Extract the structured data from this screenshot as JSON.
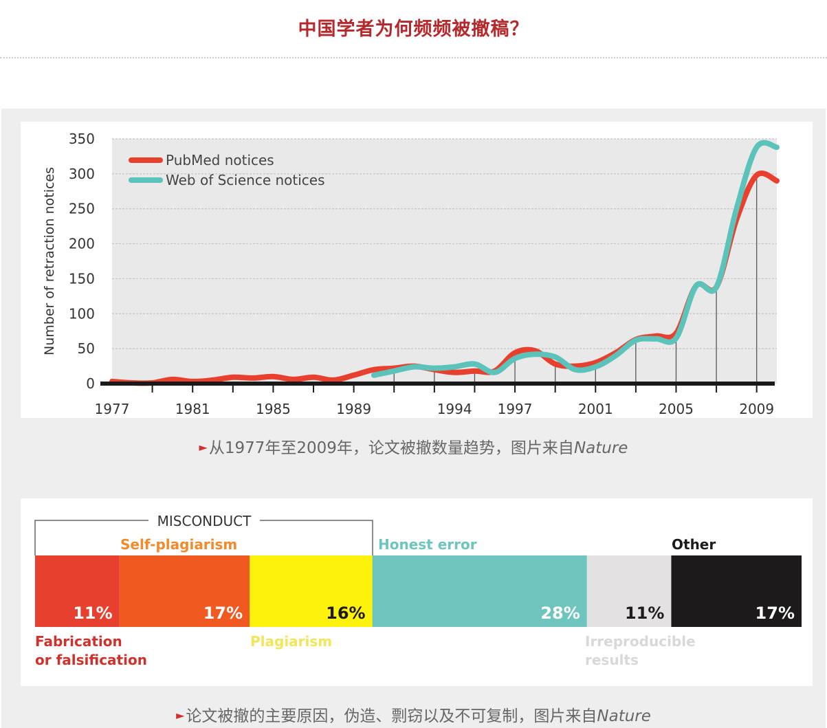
{
  "header": {
    "title": "中国学者为何频频被撤稿？"
  },
  "captions": {
    "first": {
      "prefix": "从1977年至2009年，论文被撤数量趋势，图片来自",
      "source": "Nature"
    },
    "second": {
      "prefix": "论文被撤的主要原因，伪造、剽窃以及不可复制，图片来自",
      "source": "Nature"
    }
  },
  "colors": {
    "pubmed": "#e8402f",
    "wos": "#5cc3bb",
    "fabrication": "#e8402f",
    "self_plagiarism": "#f05a20",
    "plagiarism": "#fdf20b",
    "honest_error": "#6dc5bd",
    "irreproducible": "#e3e1e2",
    "other": "#1d1a1b"
  },
  "chart_data": [
    {
      "type": "line",
      "title": "",
      "xlabel": "",
      "ylabel": "Number of retraction notices",
      "ylim": [
        0,
        350
      ],
      "xlim": [
        1977,
        2010
      ],
      "yticks": [
        "0",
        "50",
        "100",
        "150",
        "200",
        "250",
        "300",
        "350"
      ],
      "xticks": [
        "1977",
        "1981",
        "1985",
        "1989",
        "1994",
        "1997",
        "2001",
        "2005",
        "2009"
      ],
      "grid": true,
      "legend": "top-left",
      "series": [
        {
          "name": "PubMed notices",
          "x": [
            1977,
            1978,
            1979,
            1980,
            1981,
            1982,
            1983,
            1984,
            1985,
            1986,
            1987,
            1988,
            1989,
            1990,
            1991,
            1992,
            1993,
            1994,
            1995,
            1996,
            1997,
            1998,
            1999,
            2000,
            2001,
            2002,
            2003,
            2004,
            2005,
            2006,
            2007,
            2008,
            2009,
            2010
          ],
          "y": [
            3,
            1,
            1,
            6,
            3,
            5,
            9,
            8,
            10,
            6,
            9,
            5,
            12,
            20,
            22,
            25,
            20,
            16,
            18,
            18,
            44,
            47,
            28,
            25,
            30,
            44,
            63,
            68,
            72,
            140,
            138,
            235,
            298,
            290
          ]
        },
        {
          "name": "Web of Science notices",
          "x": [
            1990,
            1991,
            1992,
            1993,
            1994,
            1995,
            1996,
            1997,
            1998,
            1999,
            2000,
            2001,
            2002,
            2003,
            2004,
            2005,
            2006,
            2007,
            2008,
            2009,
            2010
          ],
          "y": [
            12,
            18,
            24,
            22,
            24,
            28,
            16,
            36,
            42,
            38,
            20,
            24,
            40,
            62,
            64,
            65,
            140,
            138,
            250,
            338,
            338
          ]
        }
      ]
    },
    {
      "type": "bar",
      "title": "",
      "group_label": "MISCONDUCT",
      "categories": [
        "Fabrication or falsification",
        "Self-plagiarism",
        "Plagiarism",
        "Honest error",
        "Irreproducible results",
        "Other"
      ],
      "values": [
        11,
        17,
        16,
        28,
        11,
        17
      ],
      "value_labels": [
        "11%",
        "17%",
        "16%",
        "28%",
        "11%",
        "17%"
      ],
      "labels": {
        "fabrication_1": "Fabrication",
        "fabrication_2": "or falsification",
        "self_plagiarism": "Self-plagiarism",
        "plagiarism": "Plagiarism",
        "honest_error": "Honest error",
        "irreproducible_1": "Irreproducible",
        "irreproducible_2": "results",
        "other": "Other"
      }
    }
  ]
}
